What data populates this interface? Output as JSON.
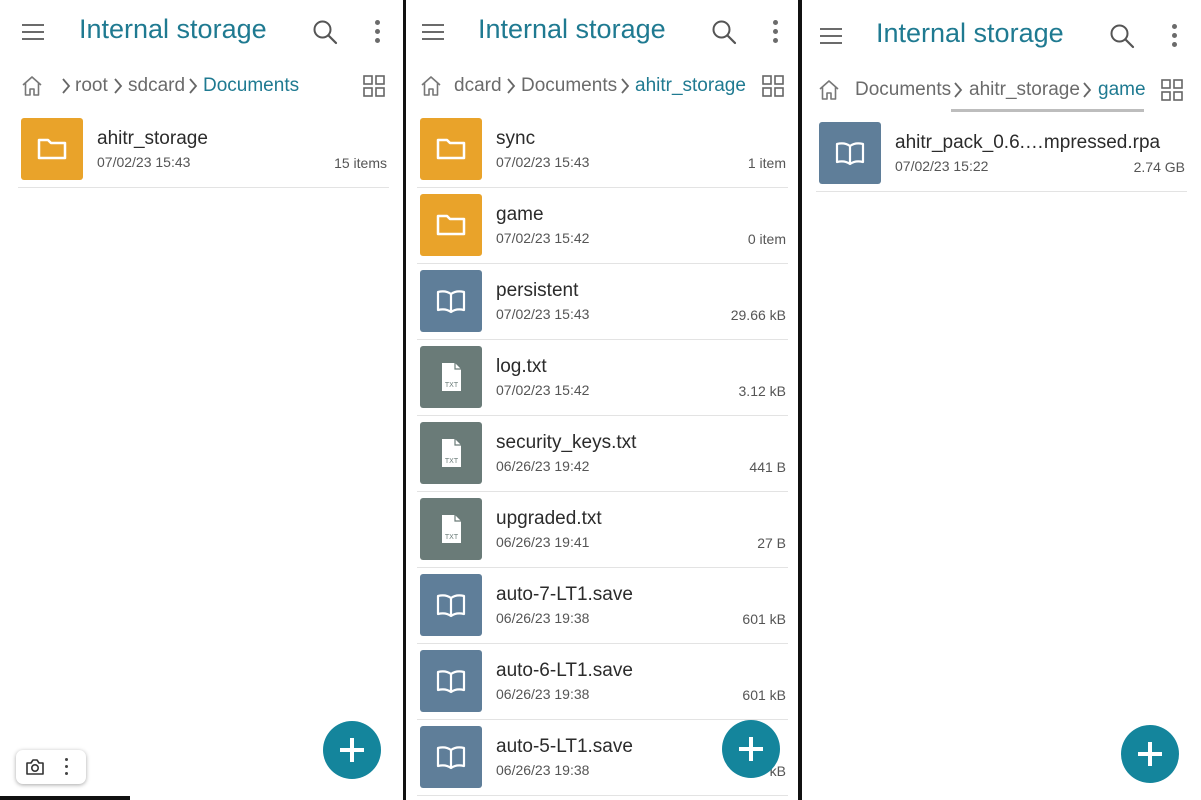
{
  "colors": {
    "accent": "#1f7a91",
    "fab": "#14859c",
    "folder": "#e9a32a",
    "book": "#5f7e99",
    "txt": "#6a7b78"
  },
  "panels": [
    {
      "title": "Internal storage",
      "breadcrumbs": [
        "root",
        "sdcard",
        "Documents"
      ],
      "files": [
        {
          "name": "ahitr_storage",
          "date": "07/02/23 15:43",
          "meta": "15 items",
          "type": "folder-icon"
        }
      ]
    },
    {
      "title": "Internal storage",
      "breadcrumbs": [
        "dcard",
        "Documents",
        "ahitr_storage"
      ],
      "files": [
        {
          "name": "sync",
          "date": "07/02/23 15:43",
          "meta": "1 item",
          "type": "folder-icon"
        },
        {
          "name": "game",
          "date": "07/02/23 15:42",
          "meta": "0 item",
          "type": "folder-icon"
        },
        {
          "name": "persistent",
          "date": "07/02/23 15:43",
          "meta": "29.66 kB",
          "type": "book-icon"
        },
        {
          "name": "log.txt",
          "date": "07/02/23 15:42",
          "meta": "3.12 kB",
          "type": "txt-file-icon"
        },
        {
          "name": "security_keys.txt",
          "date": "06/26/23 19:42",
          "meta": "441 B",
          "type": "txt-file-icon"
        },
        {
          "name": "upgraded.txt",
          "date": "06/26/23 19:41",
          "meta": "27 B",
          "type": "txt-file-icon"
        },
        {
          "name": "auto-7-LT1.save",
          "date": "06/26/23 19:38",
          "meta": "601 kB",
          "type": "book-icon"
        },
        {
          "name": "auto-6-LT1.save",
          "date": "06/26/23 19:38",
          "meta": "601 kB",
          "type": "book-icon"
        },
        {
          "name": "auto-5-LT1.save",
          "date": "06/26/23 19:38",
          "meta": "kB",
          "type": "book-icon"
        }
      ]
    },
    {
      "title": "Internal storage",
      "breadcrumbs": [
        "Documents",
        "ahitr_storage",
        "game"
      ],
      "files": [
        {
          "name": "ahitr_pack_0.6.…mpressed.rpa",
          "date": "07/02/23 15:22",
          "meta": "2.74 GB",
          "type": "book-icon"
        }
      ]
    }
  ],
  "thumb_label_txt": "TXT"
}
